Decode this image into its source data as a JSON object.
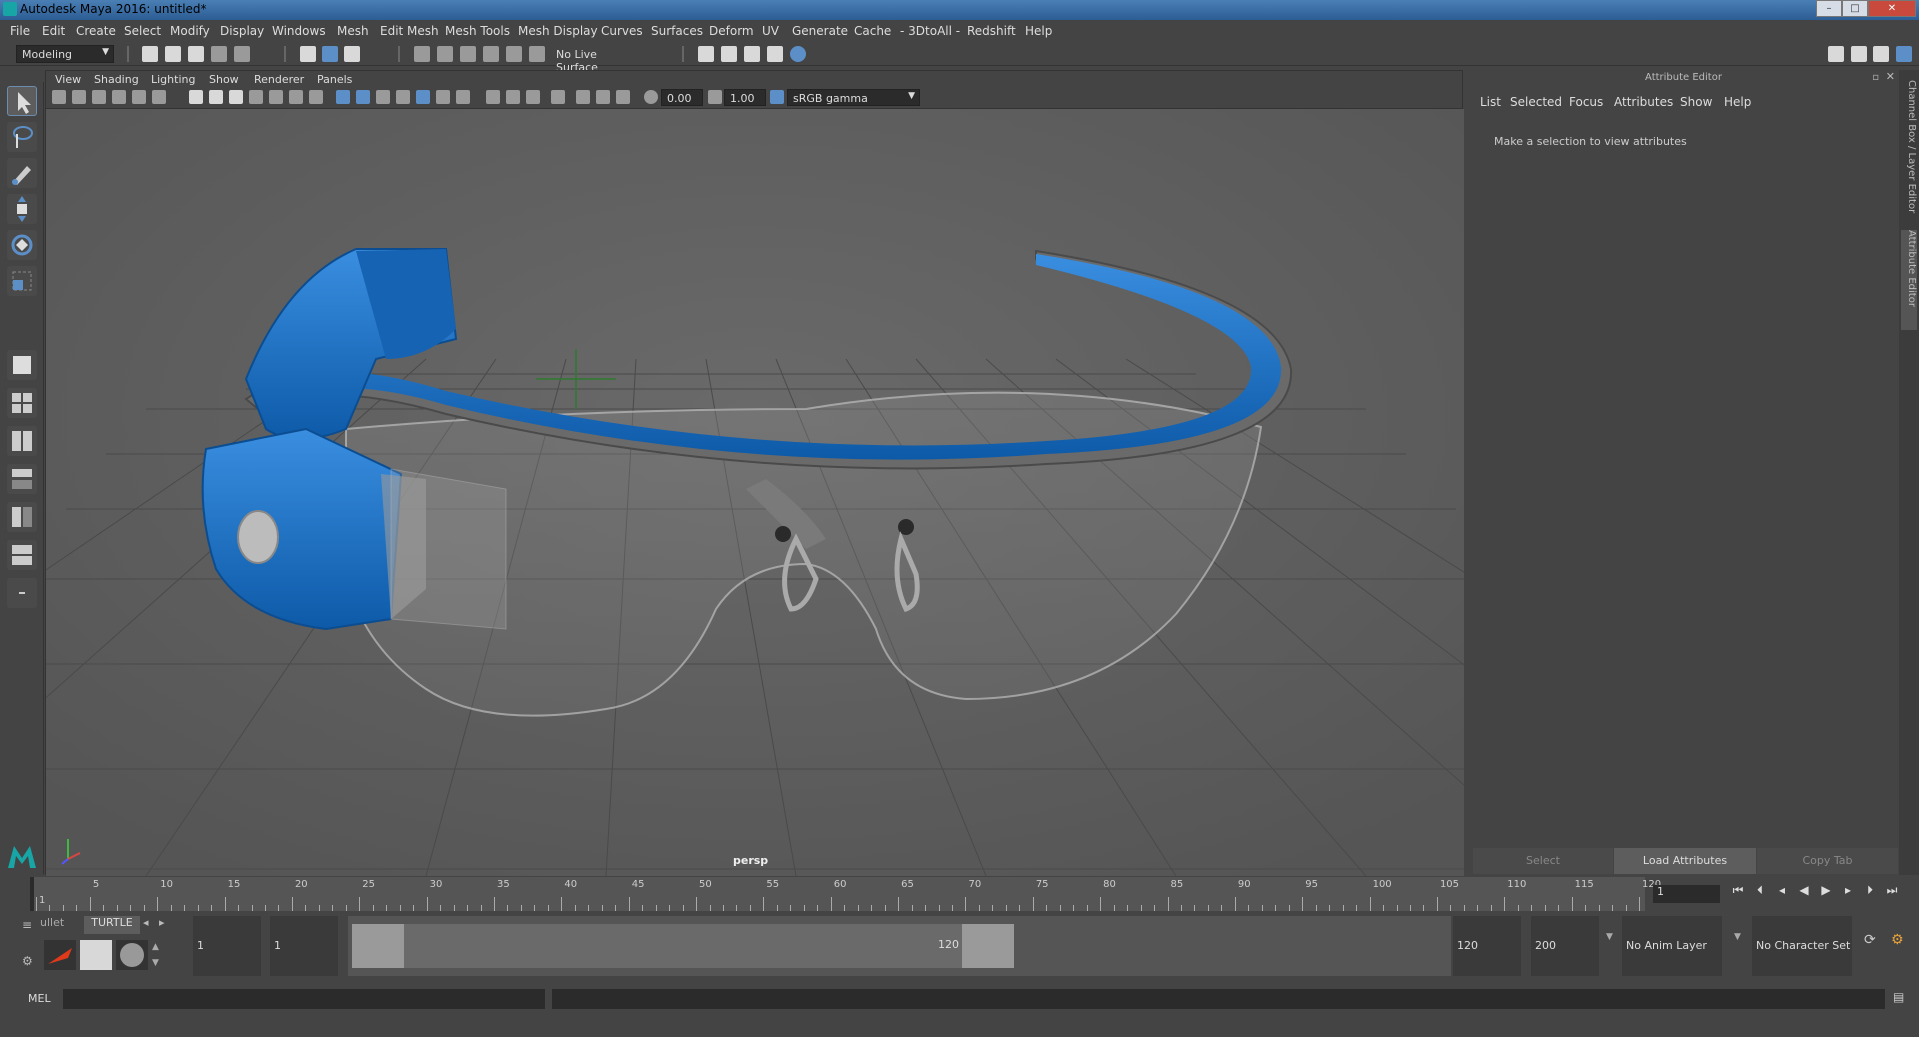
{
  "window": {
    "title": "Autodesk Maya 2016: untitled*",
    "buttons": [
      "–",
      "□",
      "✕"
    ]
  },
  "menubar": [
    "File",
    "Edit",
    "Create",
    "Select",
    "Modify",
    "Display",
    "Windows",
    "Mesh",
    "Edit Mesh",
    "Mesh Tools",
    "Mesh Display",
    "Curves",
    "Surfaces",
    "Deform",
    "UV",
    "Generate",
    "Cache",
    "- 3DtoAll -",
    "Redshift",
    "Help"
  ],
  "statusline": {
    "mode": "Modeling",
    "live_surface": "No Live Surface"
  },
  "viewport": {
    "menu": [
      "View",
      "Shading",
      "Lighting",
      "Show",
      "Renderer",
      "Panels"
    ],
    "exposure": "0.00",
    "gamma": "1.00",
    "colorspace": "sRGB gamma",
    "camera_label": "persp"
  },
  "attribute_editor": {
    "header": "Attribute Editor",
    "menu": [
      "List",
      "Selected",
      "Focus",
      "Attributes",
      "Show",
      "Help"
    ],
    "message": "Make a selection to view attributes",
    "buttons": [
      "Select",
      "Load Attributes",
      "Copy Tab"
    ],
    "side_tabs": [
      "Channel Box / Layer Editor",
      "Attribute Editor"
    ]
  },
  "timeline": {
    "ticks": [
      "1",
      "5",
      "10",
      "15",
      "20",
      "25",
      "30",
      "35",
      "40",
      "45",
      "50",
      "55",
      "60",
      "65",
      "70",
      "75",
      "80",
      "85",
      "90",
      "95",
      "100",
      "105",
      "110",
      "115",
      "120"
    ],
    "current_frame": "1"
  },
  "range": {
    "shelf_tabs": [
      "ullet",
      "TURTLE"
    ],
    "start": "1",
    "playback_start": "1",
    "range_start_label": "1",
    "range_end_label": "120",
    "playback_end": "120",
    "end": "200",
    "anim_layer": "No Anim Layer",
    "character_set": "No Character Set"
  },
  "commandline": {
    "label": "MEL"
  }
}
